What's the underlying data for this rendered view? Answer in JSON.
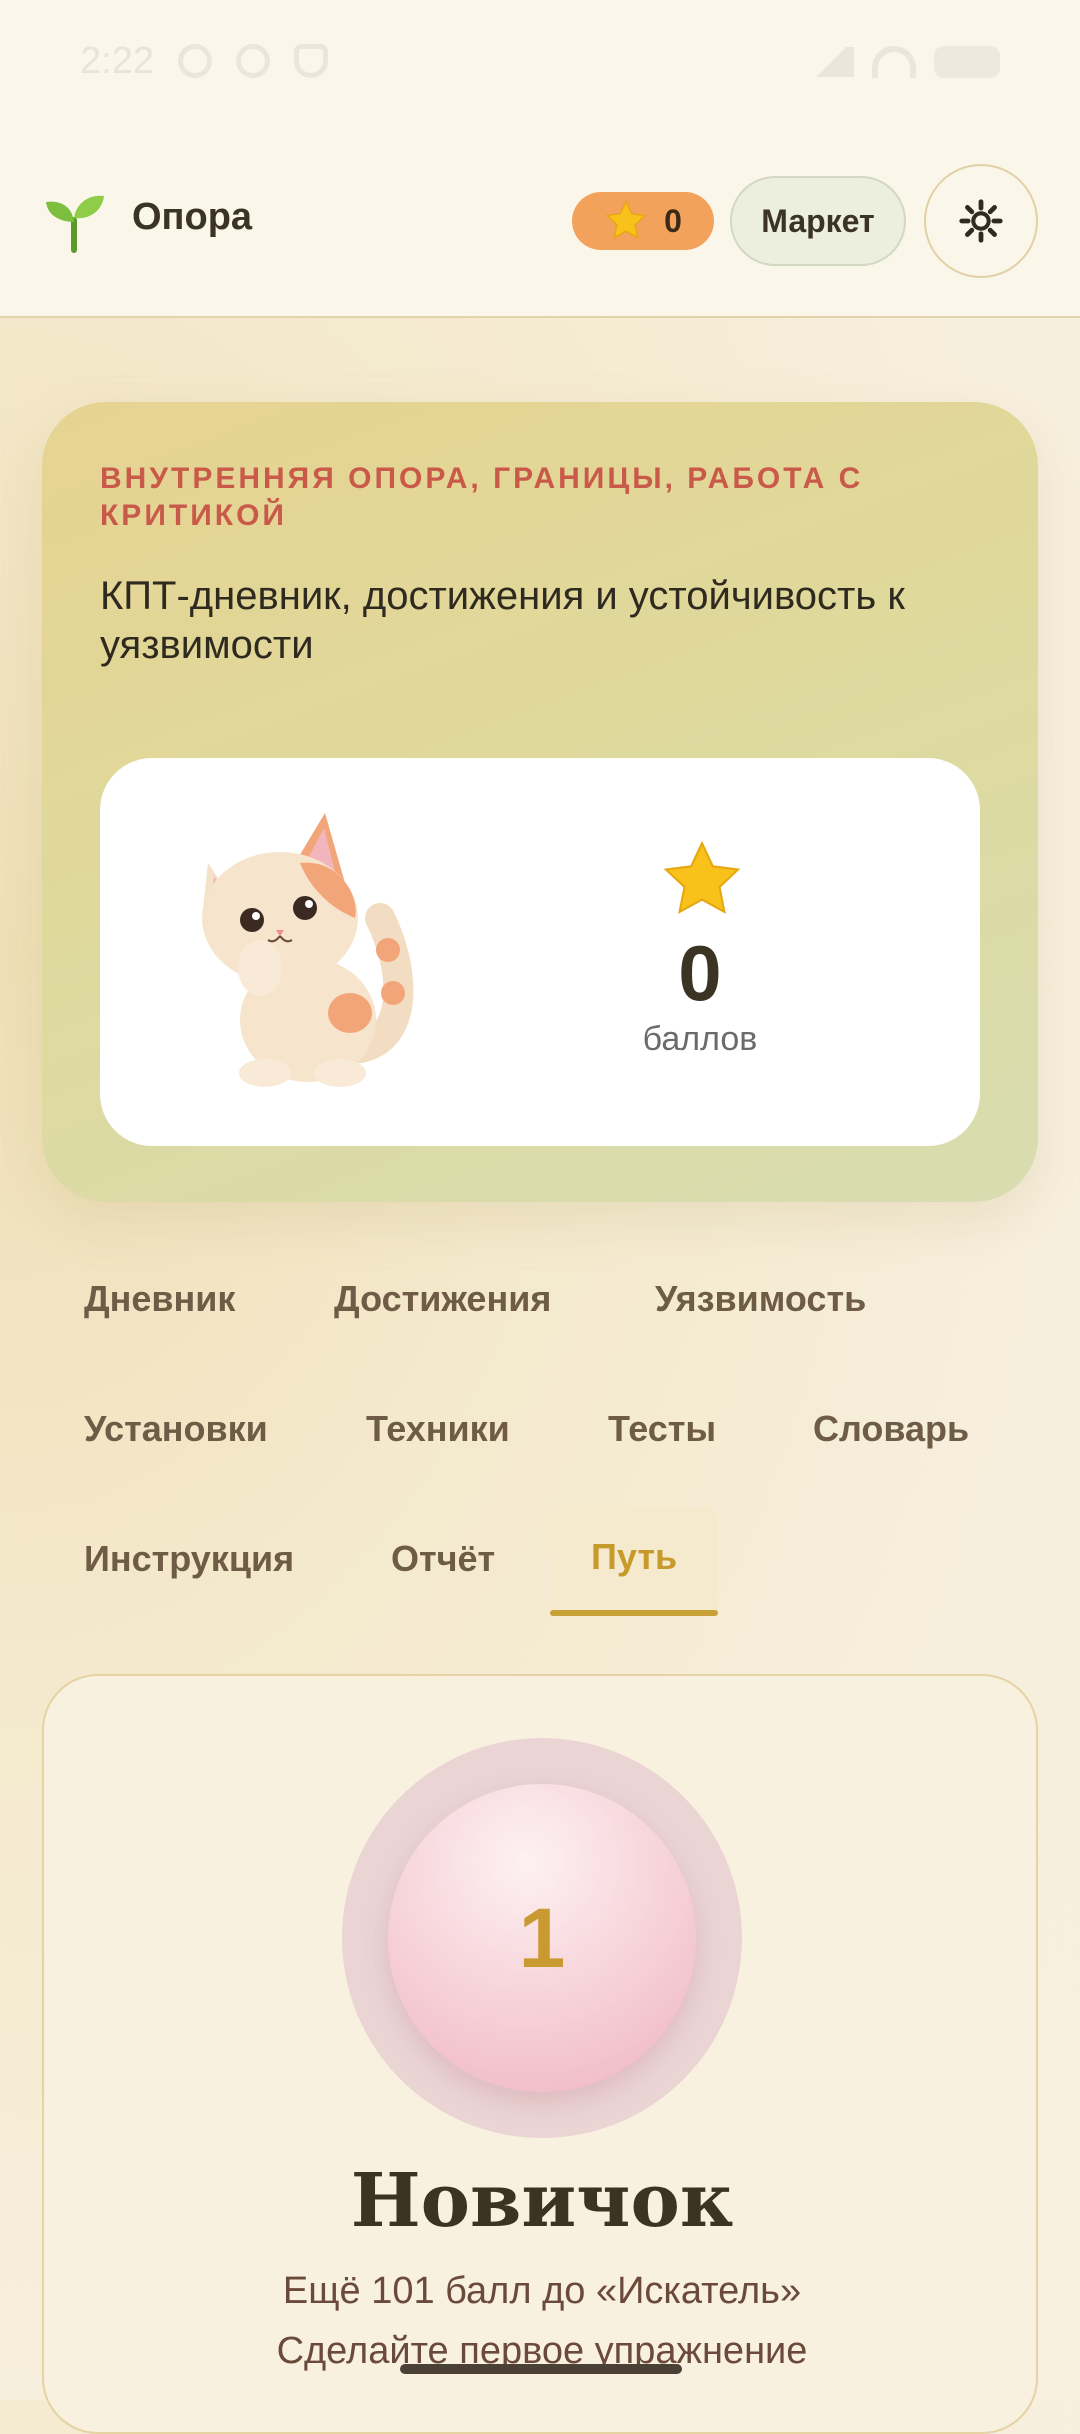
{
  "status_bar": {
    "time": "2:22"
  },
  "header": {
    "app_title": "Опора",
    "points": "0",
    "market_label": "Маркет"
  },
  "hero": {
    "subtitle": "ВНУТРЕННЯЯ ОПОРА, ГРАНИЦЫ, РАБОТА С КРИТИКОЙ",
    "title": "КПТ-дневник, достижения и устойчивость к уязвимости",
    "score": "0",
    "score_label": "баллов"
  },
  "tabs": [
    {
      "label": "Дневник"
    },
    {
      "label": "Достижения"
    },
    {
      "label": "Уязвимость"
    },
    {
      "label": "Установки"
    },
    {
      "label": "Техники"
    },
    {
      "label": "Тесты"
    },
    {
      "label": "Словарь"
    },
    {
      "label": "Инструкция"
    },
    {
      "label": "Отчёт"
    },
    {
      "label": "Путь",
      "active": true
    }
  ],
  "level": {
    "number": "1",
    "name": "Новичок",
    "next": "Ещё 101 балл до «Искатель»",
    "hint": "Сделайте первое упражнение"
  },
  "colors": {
    "accent_gold": "#c9a237",
    "points_pill": "#f3a25b",
    "subtitle_red": "#c95a4a"
  },
  "icons": [
    "sprout-icon",
    "star-icon",
    "gear-icon",
    "cat-illustration"
  ]
}
